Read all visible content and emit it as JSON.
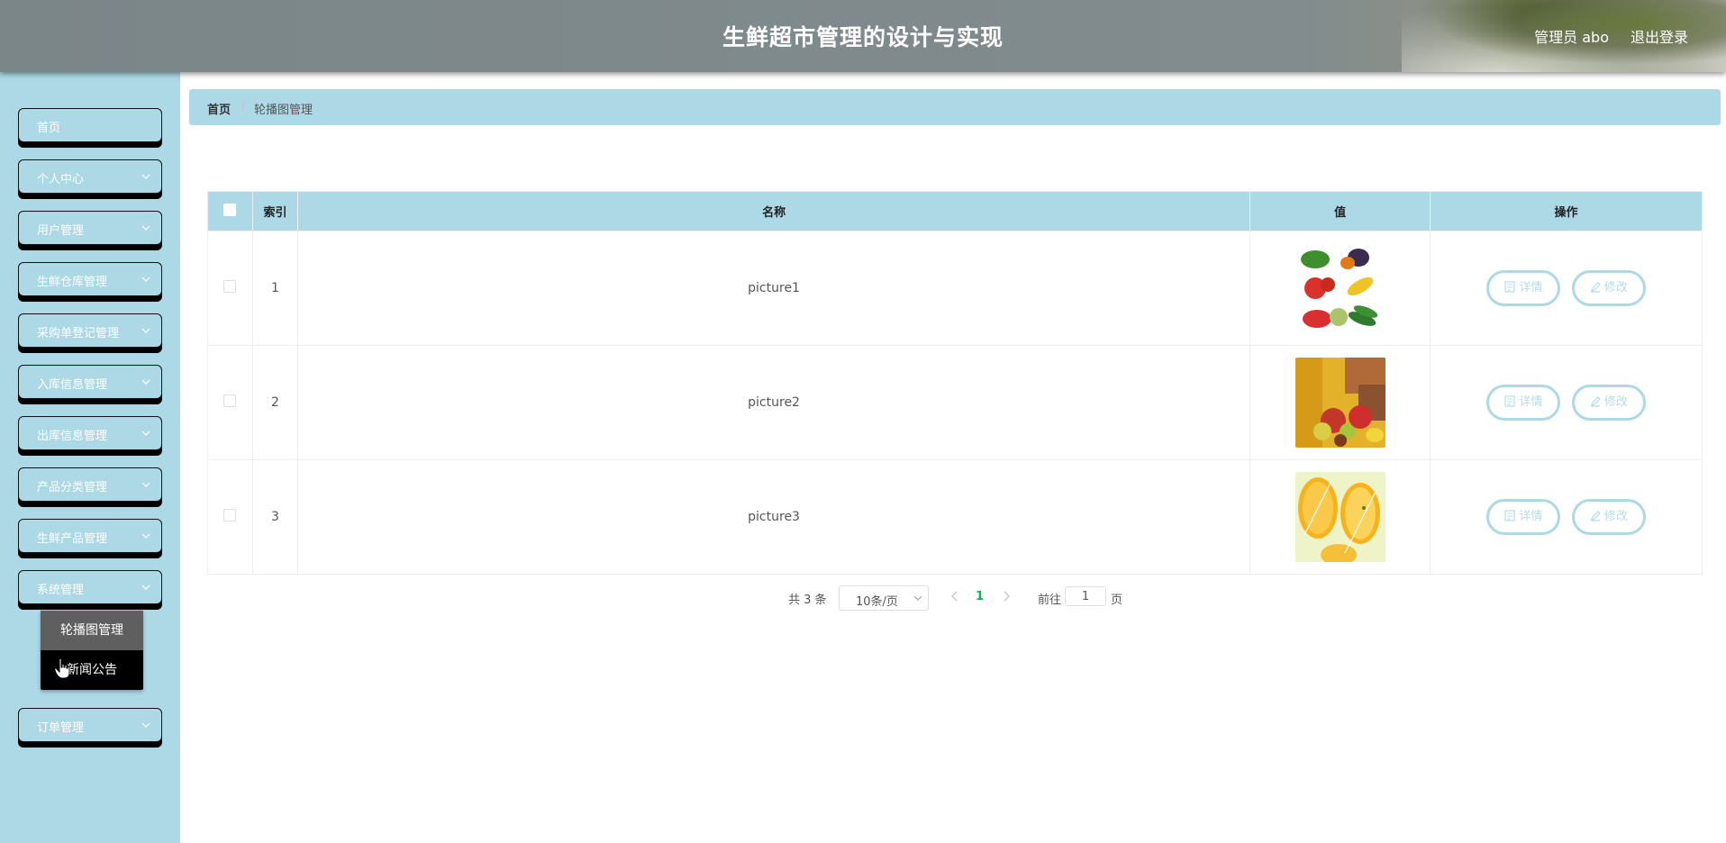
{
  "header": {
    "title": "生鲜超市管理的设计与实现",
    "user": "管理员 abo",
    "logout": "退出登录"
  },
  "sidebar": {
    "items": [
      {
        "label": "首页",
        "has_arrow": false
      },
      {
        "label": "个人中心",
        "has_arrow": true
      },
      {
        "label": "用户管理",
        "has_arrow": true
      },
      {
        "label": "生鲜仓库管理",
        "has_arrow": true
      },
      {
        "label": "采购单登记管理",
        "has_arrow": true
      },
      {
        "label": "入库信息管理",
        "has_arrow": true
      },
      {
        "label": "出库信息管理",
        "has_arrow": true
      },
      {
        "label": "产品分类管理",
        "has_arrow": true
      },
      {
        "label": "生鲜产品管理",
        "has_arrow": true
      },
      {
        "label": "系统管理",
        "has_arrow": true
      },
      {
        "label": "订单管理",
        "has_arrow": true
      }
    ],
    "submenu": [
      "轮播图管理",
      "新闻公告"
    ]
  },
  "breadcrumb": {
    "home": "首页",
    "separator": "/",
    "current": "轮播图管理"
  },
  "table": {
    "columns": [
      "索引",
      "名称",
      "值",
      "操作"
    ],
    "rows": [
      {
        "index": "1",
        "name": "picture1",
        "image": "vegetables"
      },
      {
        "index": "2",
        "name": "picture2",
        "image": "fruit-basket"
      },
      {
        "index": "3",
        "name": "picture3",
        "image": "orange-slices"
      }
    ],
    "actions": {
      "detail": "详情",
      "edit": "修改"
    }
  },
  "pagination": {
    "total": "共 3 条",
    "page_size": "10条/页",
    "current_page": "1",
    "goto_label": "前往",
    "goto_value": "1",
    "page_word": "页"
  },
  "colors": {
    "accent": "#add8e6",
    "active_page": "#1aa85a",
    "submenu_bg": "#000000"
  }
}
